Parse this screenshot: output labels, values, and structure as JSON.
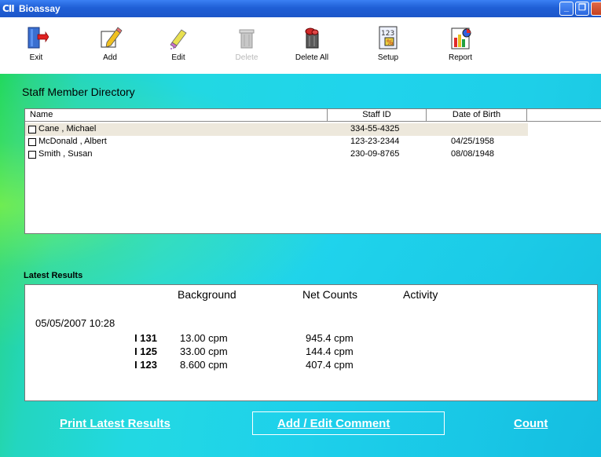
{
  "window": {
    "icon_text": "CII",
    "title": "Bioassay",
    "buttons": {
      "minimize": "_",
      "restore": "❐"
    }
  },
  "toolbar": {
    "items": [
      {
        "label": "Exit",
        "icon": "exit-door-icon",
        "enabled": true
      },
      {
        "label": "Add",
        "icon": "add-pencil-icon",
        "enabled": true
      },
      {
        "label": "Edit",
        "icon": "edit-eraser-icon",
        "enabled": true
      },
      {
        "label": "Delete",
        "icon": "trash-can-icon",
        "enabled": false
      },
      {
        "label": "Delete All",
        "icon": "trash-full-icon",
        "enabled": true
      },
      {
        "label": "Setup",
        "icon": "setup-calc-icon",
        "enabled": true
      },
      {
        "label": "Report",
        "icon": "report-chart-icon",
        "enabled": true
      }
    ],
    "setup_icon_text": "123",
    "setup_icon_pct": "%"
  },
  "directory": {
    "title": "Staff Member Directory",
    "columns": [
      "Name",
      "Staff ID",
      "Date of Birth"
    ],
    "rows": [
      {
        "name": "Cane , Michael",
        "staff_id": "334-55-4325",
        "dob": "",
        "selected": true
      },
      {
        "name": "McDonald , Albert",
        "staff_id": "123-23-2344",
        "dob": "04/25/1958",
        "selected": false
      },
      {
        "name": "Smith , Susan",
        "staff_id": "230-09-8765",
        "dob": "08/08/1948",
        "selected": false
      }
    ]
  },
  "latest": {
    "label": "Latest Results",
    "headers": {
      "background": "Background",
      "net_counts": "Net Counts",
      "activity": "Activity"
    },
    "timestamp": "05/05/2007  10:28",
    "rows": [
      {
        "isotope": "I 131",
        "background": "13.00 cpm",
        "net": "945.4 cpm"
      },
      {
        "isotope": "I 125",
        "background": "33.00 cpm",
        "net": "144.4 cpm"
      },
      {
        "isotope": "I 123",
        "background": "8.600 cpm",
        "net": "407.4 cpm"
      }
    ]
  },
  "actions": {
    "print": "Print Latest Results",
    "comment": "Add / Edit Comment",
    "count": "Count"
  },
  "colors": {
    "titlebar": "#1f5fd6",
    "background_cyan": "#22d8e2",
    "background_green": "#1ad94a"
  }
}
